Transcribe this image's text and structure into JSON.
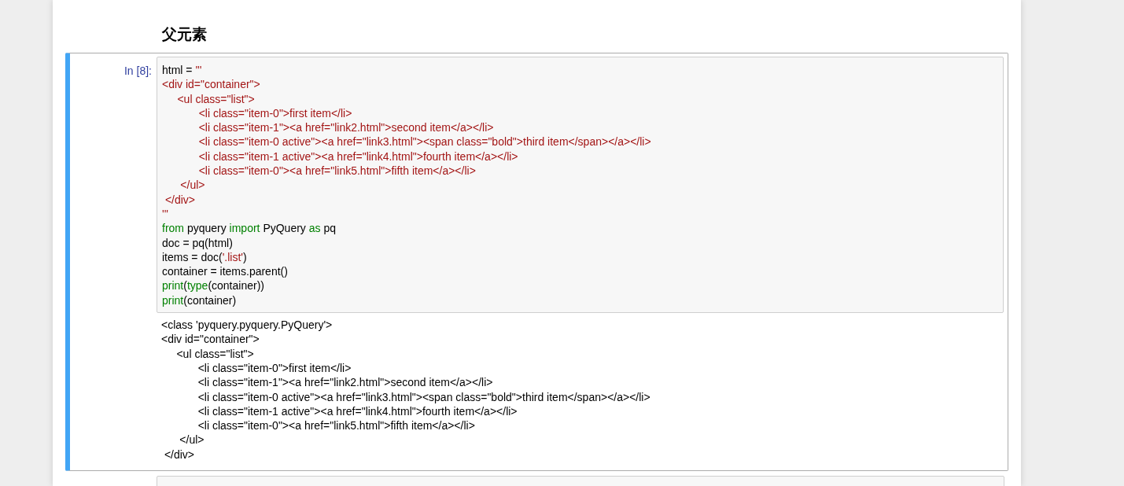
{
  "heading": "父元素",
  "cell": {
    "prompt": "In [8]:",
    "selected": true,
    "code": [
      [
        {
          "kind": "plain",
          "text": "html = "
        },
        {
          "kind": "string",
          "text": "'''"
        }
      ],
      [
        {
          "kind": "string",
          "text": "<div id=\"container\">"
        }
      ],
      [
        {
          "kind": "string",
          "text": "     <ul class=\"list\">"
        }
      ],
      [
        {
          "kind": "string",
          "text": "            <li class=\"item-0\">first item</li>"
        }
      ],
      [
        {
          "kind": "string",
          "text": "            <li class=\"item-1\"><a href=\"link2.html\">second item</a></li>"
        }
      ],
      [
        {
          "kind": "string",
          "text": "            <li class=\"item-0 active\"><a href=\"link3.html\"><span class=\"bold\">third item</span></a></li>"
        }
      ],
      [
        {
          "kind": "string",
          "text": "            <li class=\"item-1 active\"><a href=\"link4.html\">fourth item</a></li>"
        }
      ],
      [
        {
          "kind": "string",
          "text": "            <li class=\"item-0\"><a href=\"link5.html\">fifth item</a></li>"
        }
      ],
      [
        {
          "kind": "string",
          "text": "      </ul>"
        }
      ],
      [
        {
          "kind": "string",
          "text": " </div>"
        }
      ],
      [
        {
          "kind": "string",
          "text": "'''"
        }
      ],
      [
        {
          "kind": "keyword",
          "text": "from"
        },
        {
          "kind": "plain",
          "text": " pyquery "
        },
        {
          "kind": "keyword",
          "text": "import"
        },
        {
          "kind": "plain",
          "text": " PyQuery "
        },
        {
          "kind": "keyword",
          "text": "as"
        },
        {
          "kind": "plain",
          "text": " pq"
        }
      ],
      [
        {
          "kind": "plain",
          "text": "doc = pq(html)"
        }
      ],
      [
        {
          "kind": "plain",
          "text": "items = doc("
        },
        {
          "kind": "string",
          "text": "'.list'"
        },
        {
          "kind": "plain",
          "text": ")"
        }
      ],
      [
        {
          "kind": "plain",
          "text": "container = items.parent()"
        }
      ],
      [
        {
          "kind": "keyword",
          "text": "print"
        },
        {
          "kind": "plain",
          "text": "("
        },
        {
          "kind": "keyword",
          "text": "type"
        },
        {
          "kind": "plain",
          "text": "(container))"
        }
      ],
      [
        {
          "kind": "keyword",
          "text": "print"
        },
        {
          "kind": "plain",
          "text": "(container)"
        }
      ]
    ],
    "output": [
      "<class 'pyquery.pyquery.PyQuery'>",
      "<div id=\"container\">",
      "     <ul class=\"list\">",
      "            <li class=\"item-0\">first item</li>",
      "            <li class=\"item-1\"><a href=\"link2.html\">second item</a></li>",
      "            <li class=\"item-0 active\"><a href=\"link3.html\"><span class=\"bold\">third item</span></a></li>",
      "            <li class=\"item-1 active\"><a href=\"link4.html\">fourth item</a></li>",
      "            <li class=\"item-0\"><a href=\"link5.html\">fifth item</a></li>",
      "      </ul>",
      " </div>"
    ]
  }
}
